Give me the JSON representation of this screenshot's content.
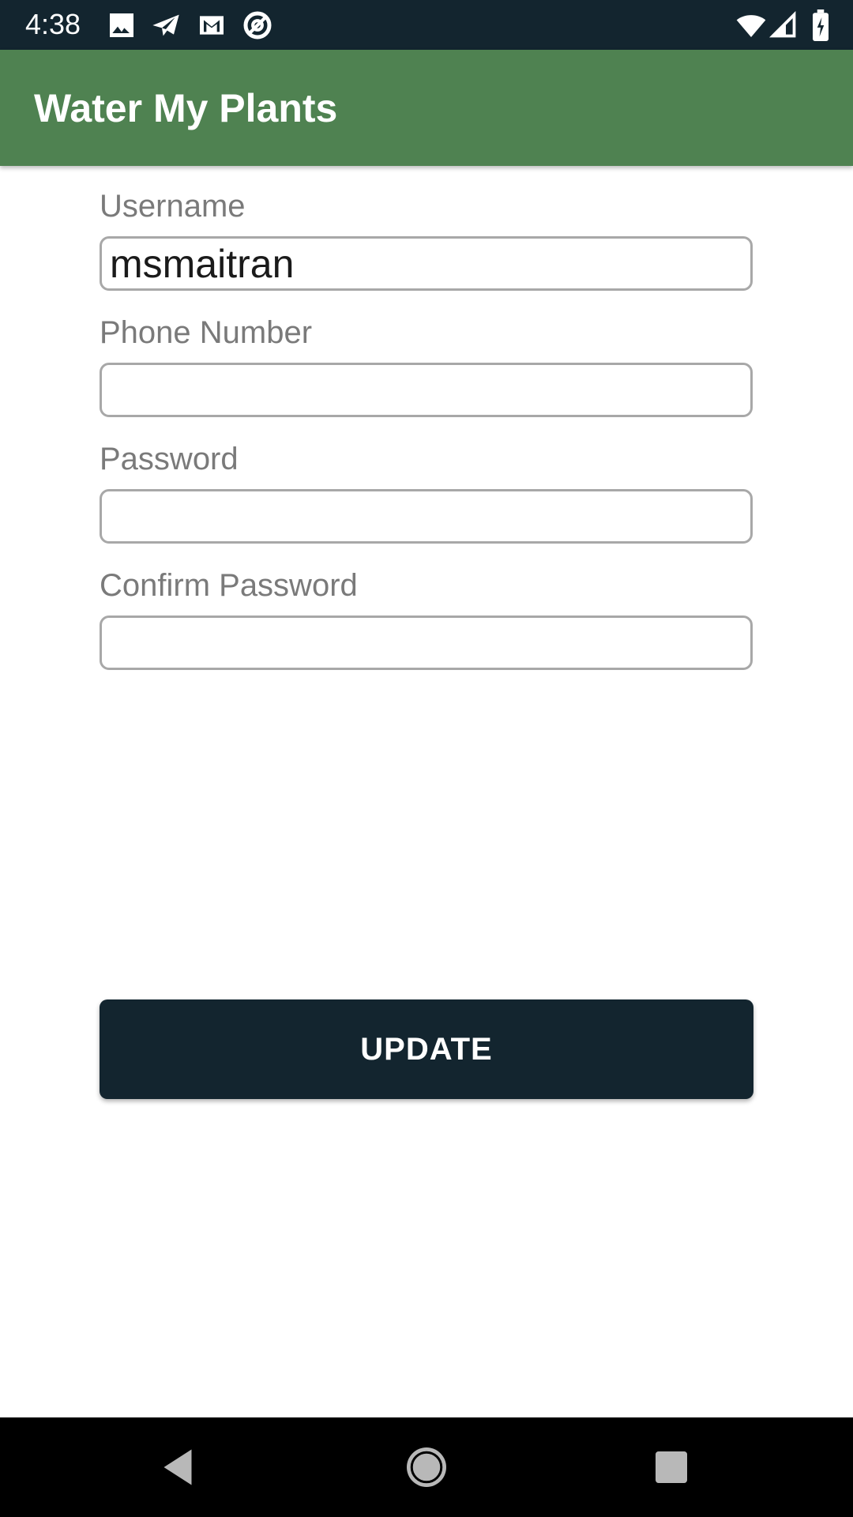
{
  "status_bar": {
    "time": "4:38",
    "left_icons": [
      "image-icon",
      "send-icon",
      "gmail-icon",
      "at-sign-icon"
    ],
    "right_icons": [
      "wifi-icon",
      "cell-signal-icon",
      "battery-charging-icon"
    ]
  },
  "app_bar": {
    "title": "Water My Plants",
    "color": "#4f8251"
  },
  "form": {
    "username": {
      "label": "Username",
      "value": "msmaitran"
    },
    "phone": {
      "label": "Phone Number",
      "value": ""
    },
    "password": {
      "label": "Password",
      "value": ""
    },
    "confirm_password": {
      "label": "Confirm Password",
      "value": ""
    }
  },
  "update_button": {
    "label": "UPDATE",
    "color": "#13252f"
  },
  "nav_bar": {
    "icons": [
      "back-icon",
      "home-icon",
      "recents-icon"
    ]
  }
}
